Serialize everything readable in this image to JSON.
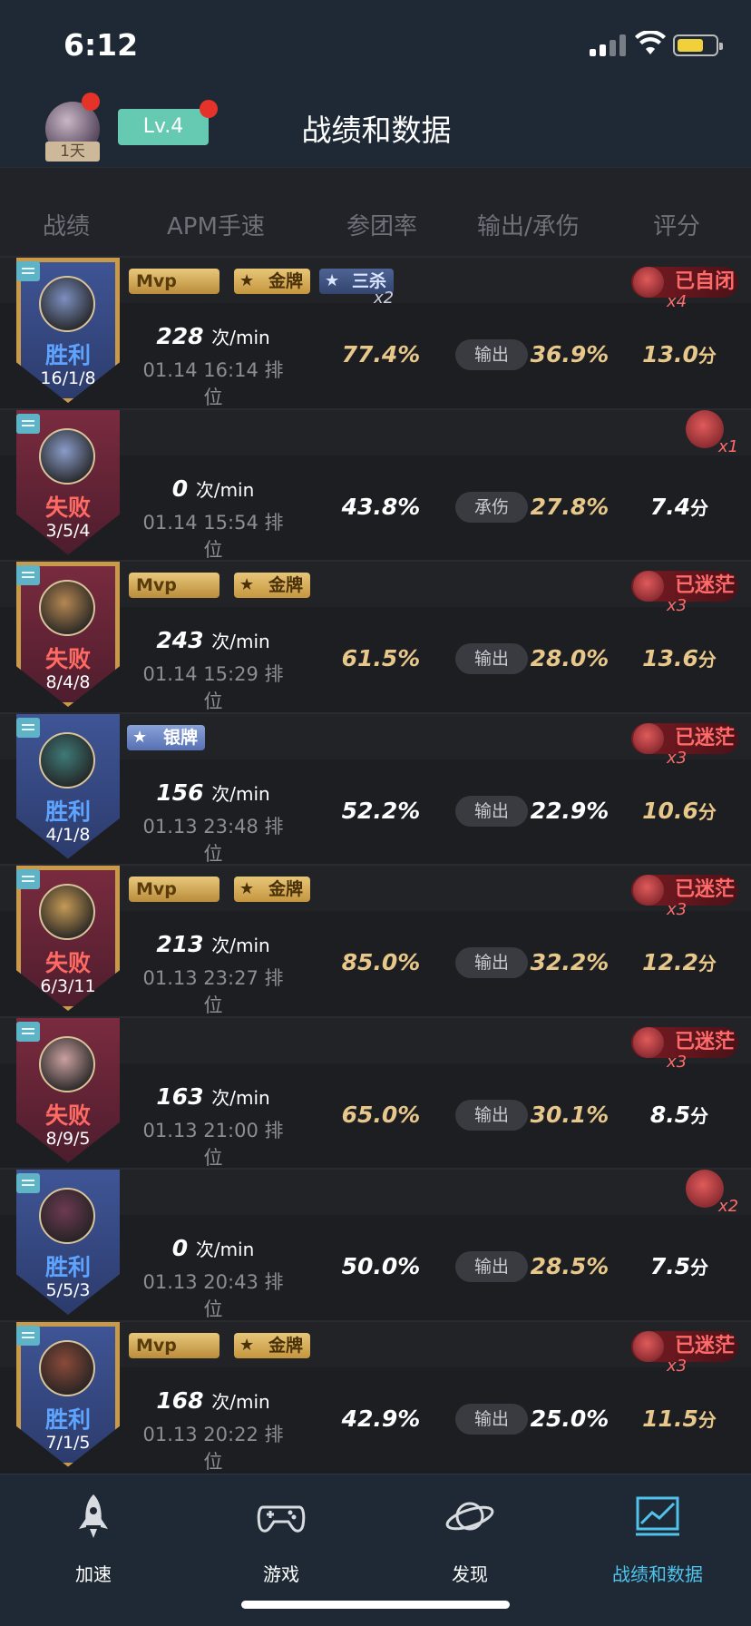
{
  "status_bar": {
    "time": "6:12"
  },
  "header": {
    "avatar_badge": "1天",
    "level": "Lv.4",
    "title": "战绩和数据"
  },
  "columns": [
    "战绩",
    "APM手速",
    "参团率",
    "输出/承伤",
    "评分"
  ],
  "apm_unit": "次/min",
  "score_unit": "分",
  "matches": [
    {
      "result": "胜利",
      "kda": "16/1/8",
      "apm": "228",
      "datetime": "01.14 16:14 排位",
      "team_rate": "77.4%",
      "dmg_type": "输出",
      "dmg_value": "36.9%",
      "score": "13.0",
      "badges": [
        "Mvp",
        "金牌",
        "三杀"
      ],
      "triple_count": "x2",
      "status": "已自闭",
      "status_count": "x4"
    },
    {
      "result": "失败",
      "kda": "3/5/4",
      "apm": "0",
      "datetime": "01.14 15:54 排位",
      "team_rate": "43.8%",
      "dmg_type": "承伤",
      "dmg_value": "27.8%",
      "score": "7.4",
      "badges": [],
      "status": "",
      "status_count": "x1"
    },
    {
      "result": "失败",
      "kda": "8/4/8",
      "apm": "243",
      "datetime": "01.14 15:29 排位",
      "team_rate": "61.5%",
      "dmg_type": "输出",
      "dmg_value": "28.0%",
      "score": "13.6",
      "badges": [
        "Mvp",
        "金牌"
      ],
      "status": "已迷茫",
      "status_count": "x3"
    },
    {
      "result": "胜利",
      "kda": "4/1/8",
      "apm": "156",
      "datetime": "01.13 23:48 排位",
      "team_rate": "52.2%",
      "dmg_type": "输出",
      "dmg_value": "22.9%",
      "score": "10.6",
      "badges": [
        "银牌"
      ],
      "status": "已迷茫",
      "status_count": "x3"
    },
    {
      "result": "失败",
      "kda": "6/3/11",
      "apm": "213",
      "datetime": "01.13 23:27 排位",
      "team_rate": "85.0%",
      "dmg_type": "输出",
      "dmg_value": "32.2%",
      "score": "12.2",
      "badges": [
        "Mvp",
        "金牌"
      ],
      "status": "已迷茫",
      "status_count": "x3"
    },
    {
      "result": "失败",
      "kda": "8/9/5",
      "apm": "163",
      "datetime": "01.13 21:00 排位",
      "team_rate": "65.0%",
      "dmg_type": "输出",
      "dmg_value": "30.1%",
      "score": "8.5",
      "badges": [],
      "status": "已迷茫",
      "status_count": "x3"
    },
    {
      "result": "胜利",
      "kda": "5/5/3",
      "apm": "0",
      "datetime": "01.13 20:43 排位",
      "team_rate": "50.0%",
      "dmg_type": "输出",
      "dmg_value": "28.5%",
      "score": "7.5",
      "badges": [],
      "status": "",
      "status_count": "x2"
    },
    {
      "result": "胜利",
      "kda": "7/1/5",
      "apm": "168",
      "datetime": "01.13 20:22 排位",
      "team_rate": "42.9%",
      "dmg_type": "输出",
      "dmg_value": "25.0%",
      "score": "11.5",
      "badges": [
        "Mvp",
        "金牌"
      ],
      "status": "已迷茫",
      "status_count": "x3"
    }
  ],
  "tabs": [
    {
      "label": "加速",
      "icon": "rocket-icon"
    },
    {
      "label": "游戏",
      "icon": "gamepad-icon"
    },
    {
      "label": "发现",
      "icon": "planet-icon"
    },
    {
      "label": "战绩和数据",
      "icon": "chart-icon"
    }
  ],
  "colors": {
    "header_bg": "#1e2935",
    "accent": "#4fc3ec",
    "win": "#5ea4ff",
    "lose": "#ff6a63",
    "gold_text": "#e8c78a"
  }
}
